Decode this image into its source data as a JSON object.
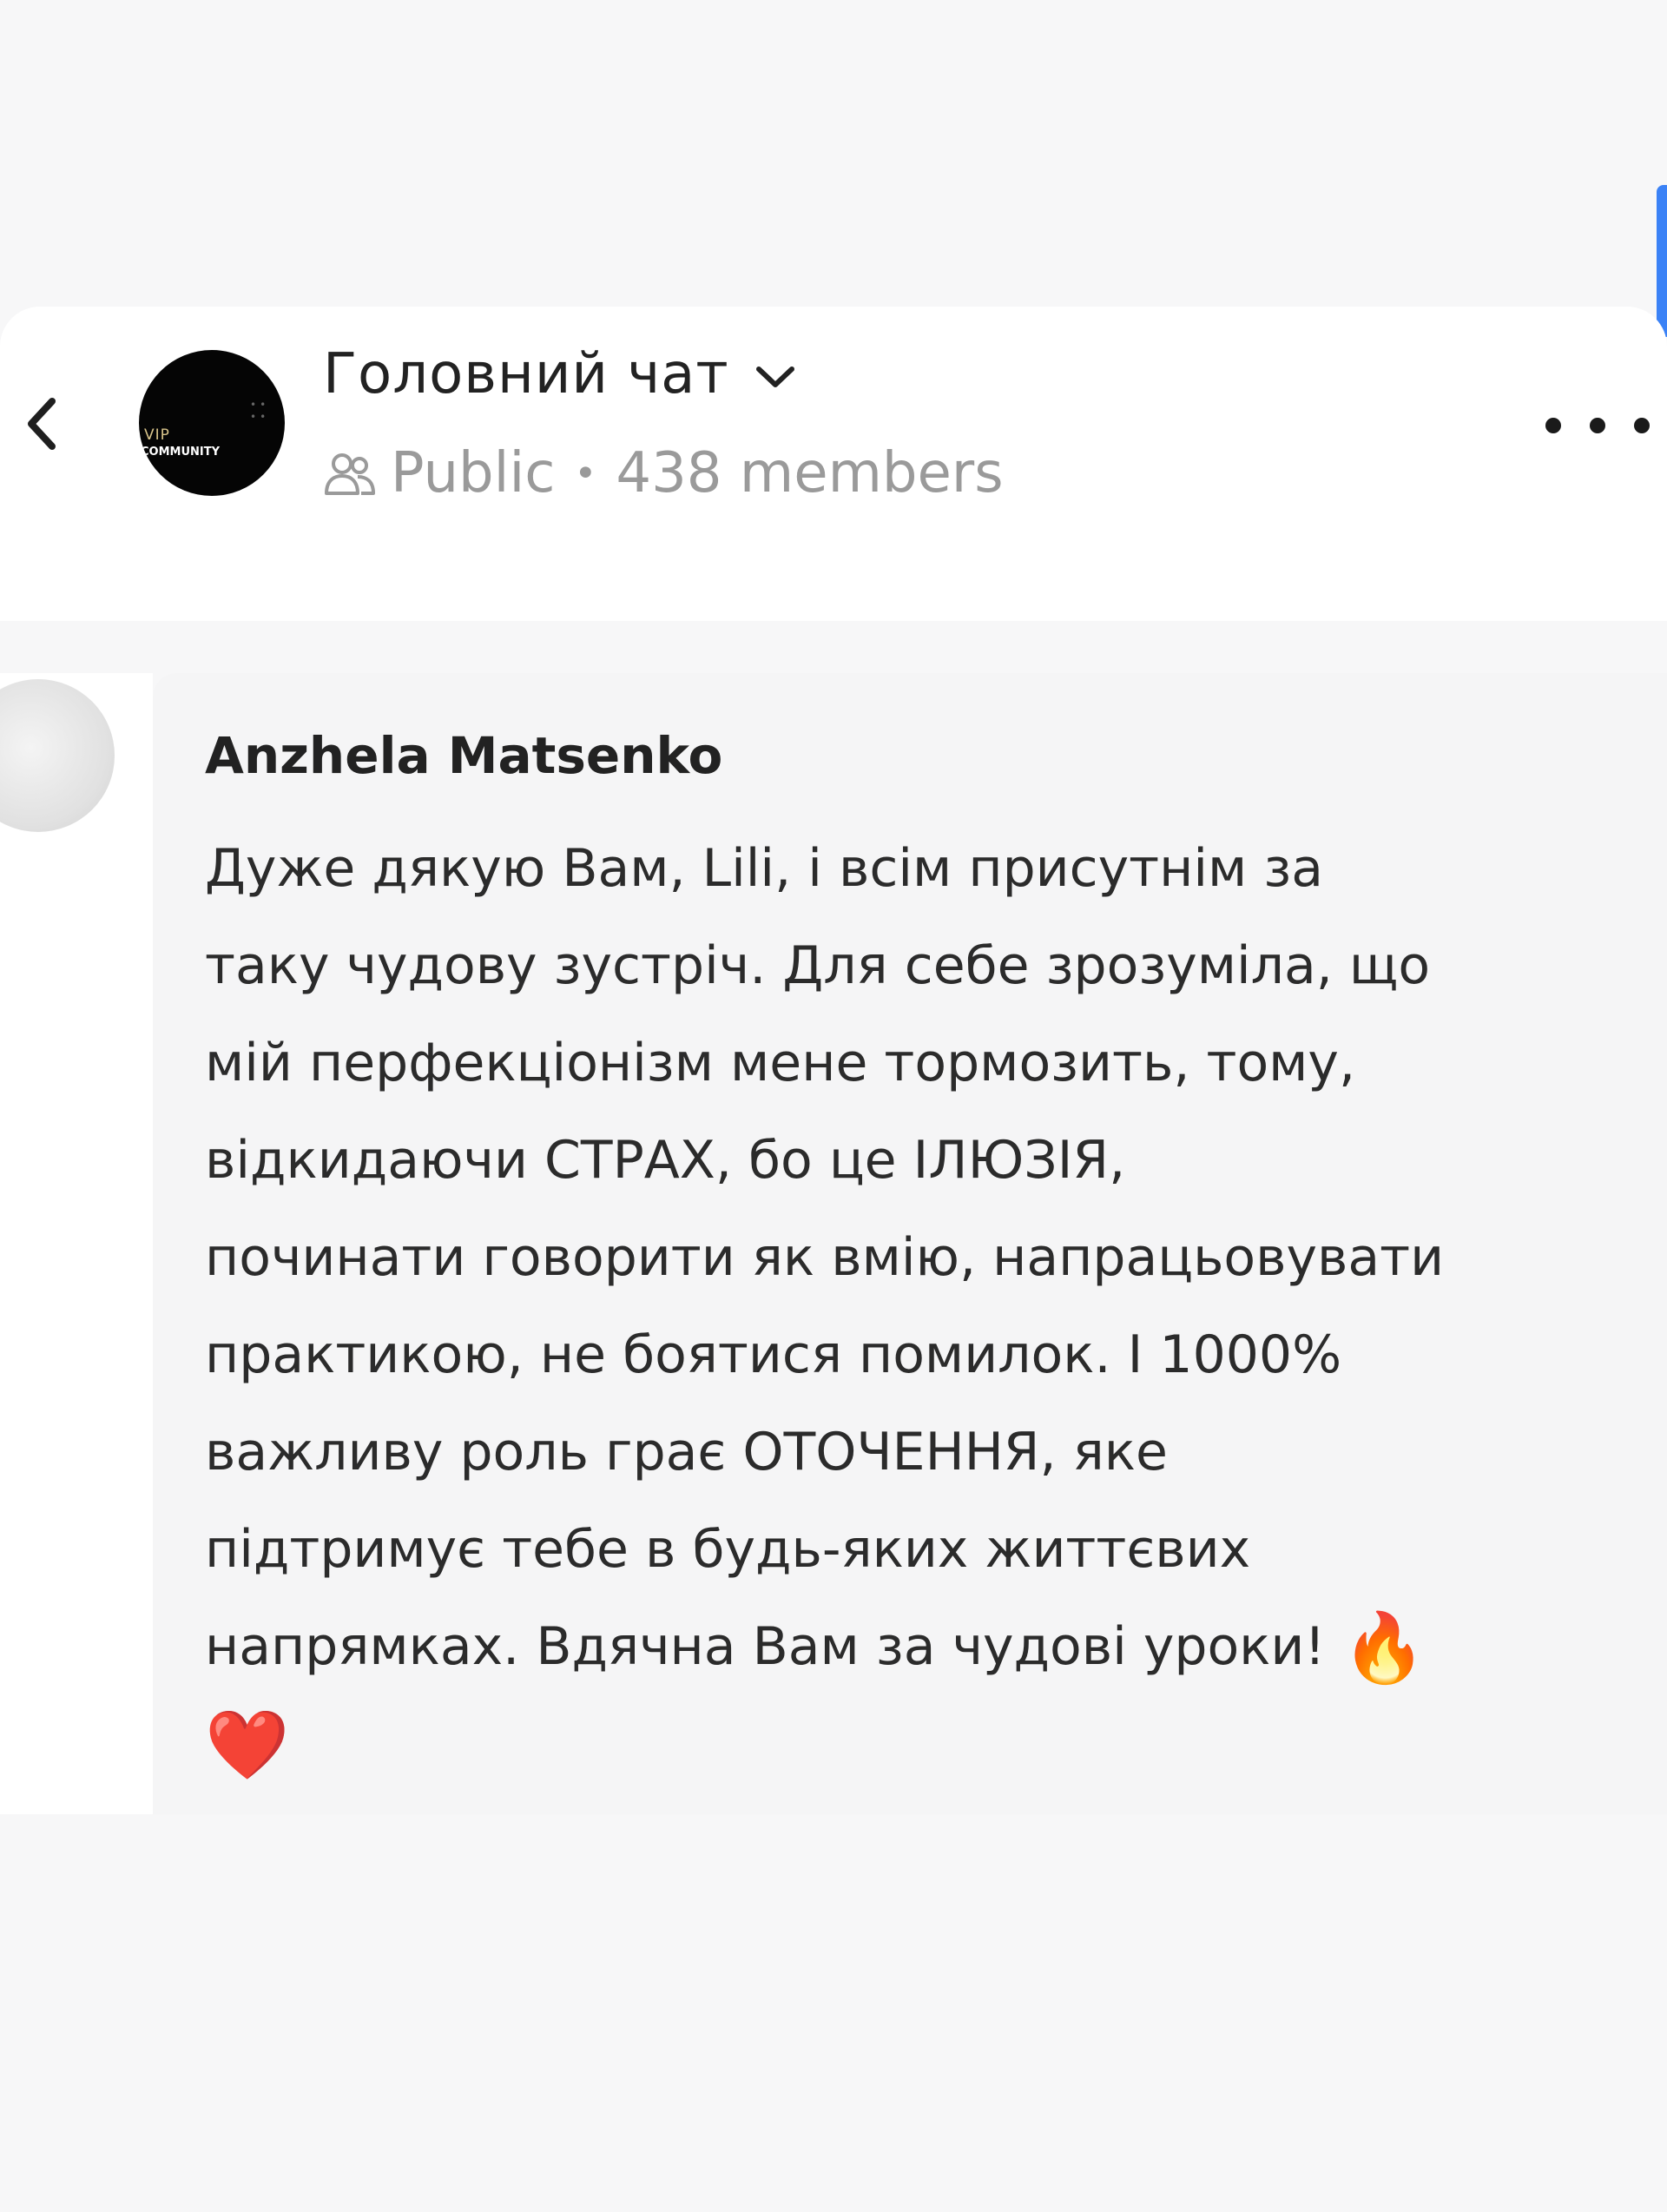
{
  "header": {
    "title": "Головний чат",
    "visibility": "Public",
    "separator": "•",
    "members": "438 members",
    "avatar_text_1": "VIP",
    "avatar_text_2": "COMMUNITY"
  },
  "message": {
    "author": "Anzhela Matsenko",
    "lines": [
      "Дуже дякую Вам, Lili, і всім присутнім за",
      "таку чудову зустріч. Для себе зрозуміла, що",
      "мій перфекціонізм мене тормозить, тому,",
      "відкидаючи СТРАХ, бо це ІЛЮЗІЯ,",
      "починати говорити як вмію, напрацьовувати",
      "практикою, не боятися помилок. І 1000%",
      "важливу роль грає ОТОЧЕННЯ, яке",
      "підтримує тебе в будь-яких життєвих",
      "напрямках. Вдячна Вам за чудові уроки!"
    ],
    "emoji_fire": "🔥",
    "emoji_heart": "❤️"
  },
  "icons": {
    "back": "back-chevron-icon",
    "dropdown": "chevron-down-icon",
    "people": "people-icon",
    "more": "more-dots-icon"
  }
}
